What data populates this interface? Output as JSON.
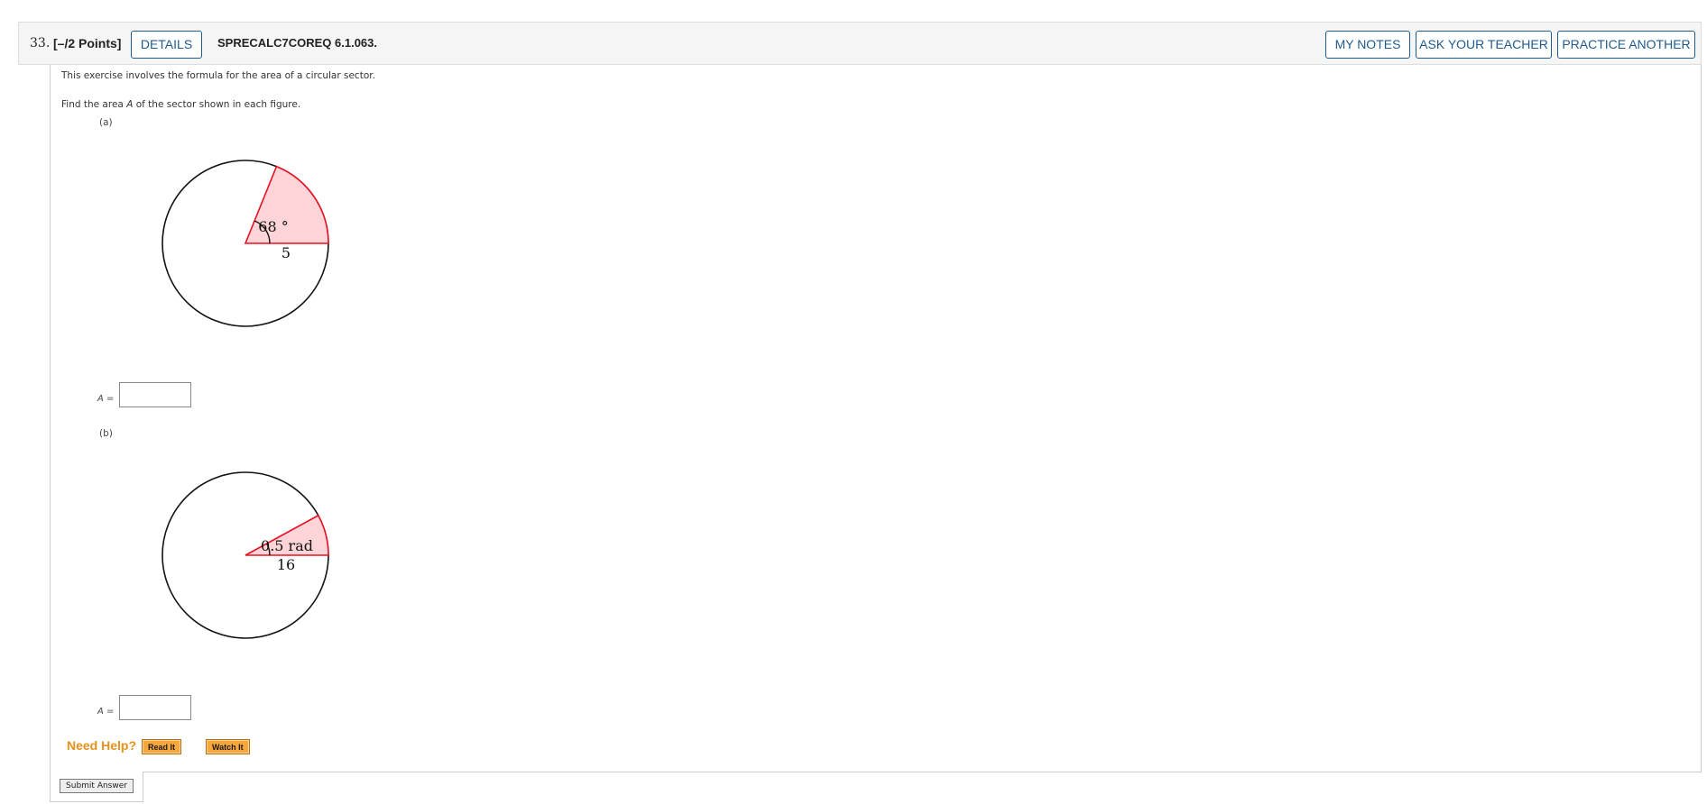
{
  "question": {
    "number": "33.",
    "points": "[–/2 Points]",
    "details_label": "DETAILS",
    "code": "SPRECALC7COREQ 6.1.063.",
    "my_notes_label": "MY NOTES",
    "ask_teacher_label": "ASK YOUR TEACHER",
    "practice_another_label": "PRACTICE ANOTHER"
  },
  "body": {
    "intro": "This exercise involves the formula for the area of a circular sector.",
    "instruction_prefix": "Find the area ",
    "instruction_var": "A",
    "instruction_suffix": " of the sector shown in each figure."
  },
  "parts": [
    {
      "label": "(a)",
      "angle_label": "68 °",
      "radius_label": "5",
      "angle_value_degrees": 68,
      "radius_value": 5,
      "answer_var": "A",
      "answer_eq": "=",
      "answer_value": ""
    },
    {
      "label": "(b)",
      "angle_label": "0.5 rad",
      "radius_label": "16",
      "angle_value_radians": 0.5,
      "radius_value": 16,
      "answer_var": "A",
      "answer_eq": "=",
      "answer_value": ""
    }
  ],
  "help": {
    "label": "Need Help?",
    "read_label": "Read It",
    "watch_label": "Watch It"
  },
  "submit_label": "Submit Answer",
  "colors": {
    "sector_fill": "#fdd5d9",
    "sector_stroke": "#e81123",
    "button_blue": "#1f5b8f",
    "help_orange": "#e8901a"
  }
}
